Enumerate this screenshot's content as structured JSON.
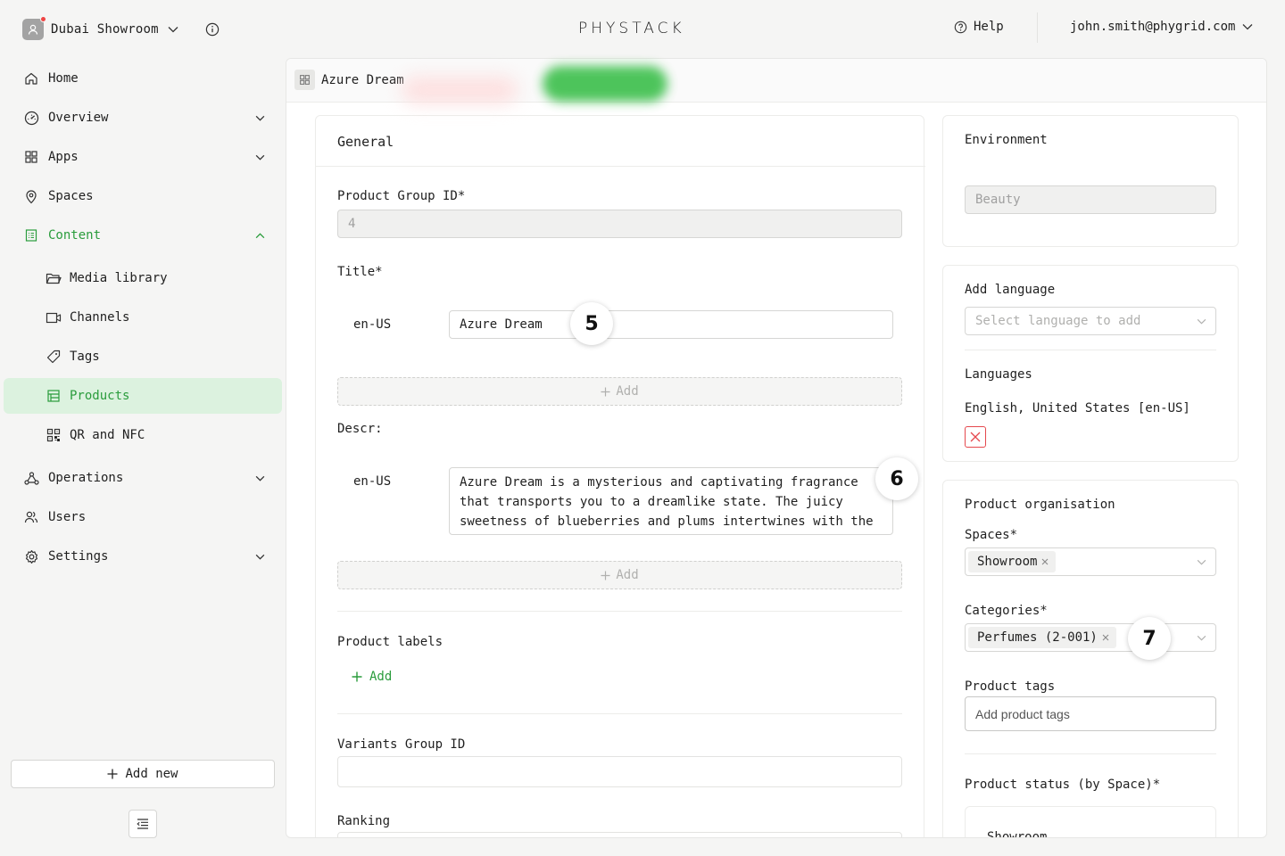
{
  "header": {
    "org_name": "Dubai Showroom",
    "logo": "PHYSTACK",
    "help_label": "Help",
    "user_email": "john.smith@phygrid.com"
  },
  "sidebar": {
    "items": [
      {
        "label": "Home",
        "icon": "home-icon"
      },
      {
        "label": "Overview",
        "icon": "gauge-icon"
      },
      {
        "label": "Apps",
        "icon": "grid-icon"
      },
      {
        "label": "Spaces",
        "icon": "location-pin-icon"
      },
      {
        "label": "Content",
        "icon": "document-icon"
      },
      {
        "label": "Media library",
        "icon": "folder-icon"
      },
      {
        "label": "Channels",
        "icon": "video-icon"
      },
      {
        "label": "Tags",
        "icon": "tag-icon"
      },
      {
        "label": "Products",
        "icon": "storefront-icon"
      },
      {
        "label": "QR and NFC",
        "icon": "qr-code-icon"
      },
      {
        "label": "Operations",
        "icon": "nodes-icon"
      },
      {
        "label": "Users",
        "icon": "users-icon"
      },
      {
        "label": "Settings",
        "icon": "gear-icon"
      }
    ],
    "add_new_label": "Add new"
  },
  "tab": {
    "title": "Azure Dream"
  },
  "general": {
    "title": "General",
    "group_id_label": "Product Group ID",
    "group_id_value": "4",
    "title_label": "Title",
    "title_locale": "en-US",
    "title_value": "Azure Dream",
    "add_label": "Add",
    "descr_label": "Descr:",
    "descr_locale": "en-US",
    "descr_value": "Azure Dream is a mysterious and captivating fragrance that transports you to a dreamlike state. The juicy sweetness of blueberries and plums intertwines with the",
    "labels_title": "Product labels",
    "labels_add": "Add",
    "variants_label": "Variants Group ID",
    "variants_value": "",
    "ranking_label": "Ranking",
    "required_mark": "*"
  },
  "environment": {
    "title": "Environment",
    "value": "Beauty"
  },
  "language": {
    "title": "Add language",
    "placeholder": "Select language to add",
    "languages_title": "Languages",
    "languages_value": "English, United States [en-US]"
  },
  "organisation": {
    "title": "Product organisation",
    "spaces_label": "Spaces",
    "spaces_tag": "Showroom",
    "categories_label": "Categories",
    "categories_tag": "Perfumes (2-001)",
    "tags_label": "Product tags",
    "tags_placeholder": "Add product tags",
    "status_label": "Product status (by Space)",
    "status_space": "Showroom"
  },
  "markers": [
    "5",
    "6",
    "7"
  ],
  "colors": {
    "accent": "#2a9c3c",
    "active_bg": "#dcf2df",
    "danger": "#e5484d"
  }
}
